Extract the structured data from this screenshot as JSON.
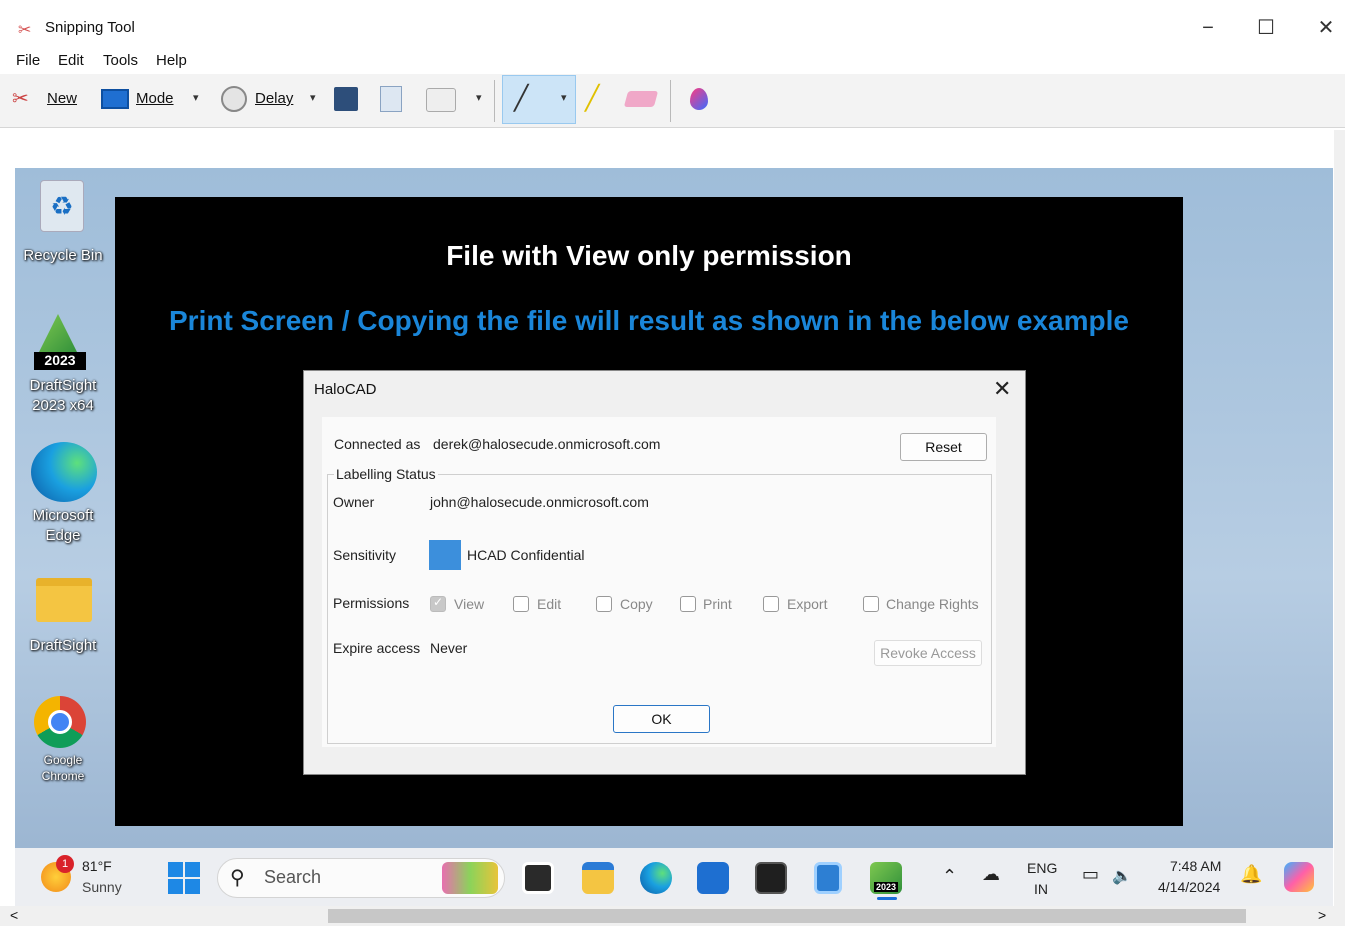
{
  "window": {
    "title": "Snipping Tool",
    "minimize": "−",
    "maximize": "☐",
    "close": "✕"
  },
  "menubar": [
    "File",
    "Edit",
    "Tools",
    "Help"
  ],
  "toolbar": {
    "new_label": "New",
    "mode_label": "Mode",
    "delay_label": "Delay",
    "dropdown": "▾"
  },
  "desktop_icons": {
    "recycle_bin": "Recycle Bin",
    "draftsight_badge": "2023",
    "draftsight_x64": [
      "DraftSight",
      "2023 x64"
    ],
    "edge": [
      "Microsoft",
      "Edge"
    ],
    "draftsight_folder": "DraftSight",
    "chrome": [
      "Google",
      "Chrome"
    ]
  },
  "banner": {
    "title": "File with View only permission",
    "subtitle": "Print Screen / Copying the file will result as shown in the below example"
  },
  "dialog": {
    "title": "HaloCAD",
    "close": "✕",
    "connected_as_label": "Connected as",
    "connected_as_value": "derek@halosecude.onmicrosoft.com",
    "reset_button": "Reset",
    "labelling_status": "Labelling Status",
    "owner_label": "Owner",
    "owner_value": "john@halosecude.onmicrosoft.com",
    "sensitivity_label": "Sensitivity",
    "sensitivity_value": "HCAD Confidential",
    "sensitivity_color": "#3c8fdc",
    "permissions_label": "Permissions",
    "permissions": [
      {
        "label": "View",
        "checked": true
      },
      {
        "label": "Edit",
        "checked": false
      },
      {
        "label": "Copy",
        "checked": false
      },
      {
        "label": "Print",
        "checked": false
      },
      {
        "label": "Export",
        "checked": false
      },
      {
        "label": "Change Rights",
        "checked": false
      }
    ],
    "expire_label": "Expire access",
    "expire_value": "Never",
    "revoke_button": "Revoke Access",
    "ok_button": "OK"
  },
  "taskbar": {
    "weather_temp": "81°F",
    "weather_desc": "Sunny",
    "weather_badge": "1",
    "search_placeholder": "Search",
    "tray_lang": "ENG",
    "tray_region": "IN",
    "time": "7:48 AM",
    "date": "4/14/2024",
    "draftsight_badge": "2023"
  },
  "scroll": {
    "left": "<",
    "right": ">"
  }
}
